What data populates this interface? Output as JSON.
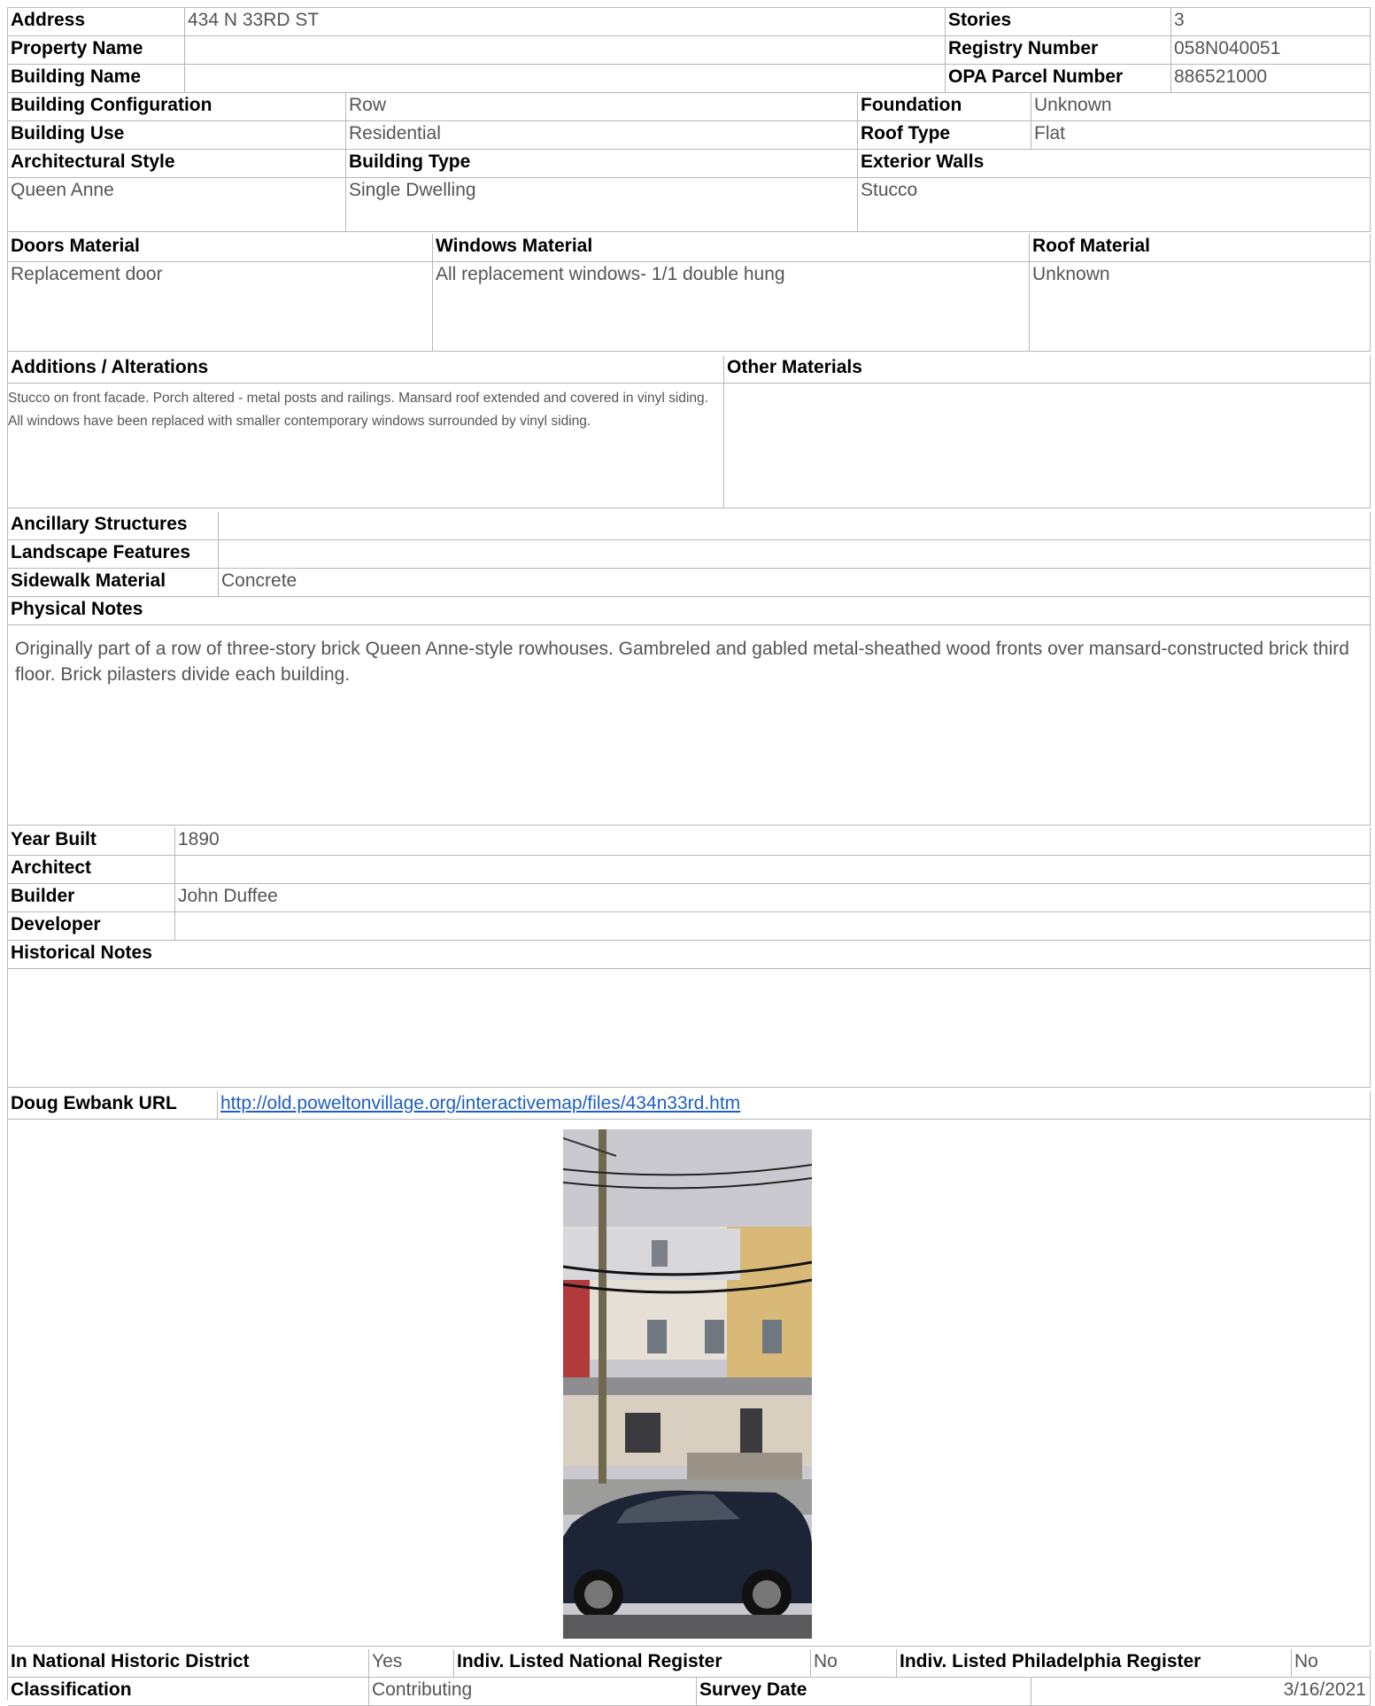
{
  "identity": {
    "address_label": "Address",
    "address": "434 N 33RD ST",
    "property_name_label": "Property Name",
    "property_name": "",
    "building_name_label": "Building Name",
    "building_name": "",
    "stories_label": "Stories",
    "stories": "3",
    "registry_label": "Registry Number",
    "registry": "058N040051",
    "opa_label": "OPA Parcel Number",
    "opa": "886521000"
  },
  "building": {
    "config_label": "Building Configuration",
    "config": "Row",
    "foundation_label": "Foundation",
    "foundation": "Unknown",
    "use_label": "Building Use",
    "use": "Residential",
    "roof_type_label": "Roof Type",
    "roof_type": "Flat",
    "style_label": "Architectural Style",
    "style": "Queen Anne",
    "type_label": "Building Type",
    "type": "Single Dwelling",
    "walls_label": "Exterior Walls",
    "walls": "Stucco"
  },
  "materials": {
    "doors_label": "Doors Material",
    "doors": "Replacement door",
    "windows_label": "Windows Material",
    "windows": "All replacement windows- 1/1 double hung",
    "roof_label": "Roof Material",
    "roof": "Unknown"
  },
  "alterations": {
    "additions_label": "Additions / Alterations",
    "additions": "Stucco on front facade. Porch altered - metal posts and railings. Mansard roof extended and covered in vinyl siding. All windows have been replaced with smaller contemporary windows surrounded by vinyl siding.",
    "other_label": "Other Materials",
    "other": ""
  },
  "site": {
    "ancillary_label": "Ancillary Structures",
    "ancillary": "",
    "landscape_label": "Landscape Features",
    "landscape": "",
    "sidewalk_label": "Sidewalk Material",
    "sidewalk": "Concrete"
  },
  "physical": {
    "label": "Physical Notes",
    "text": "Originally part of a row of three-story brick Queen Anne-style rowhouses. Gambreled and gabled metal-sheathed wood fronts over mansard-constructed brick third floor. Brick pilasters divide each building."
  },
  "history": {
    "year_label": "Year Built",
    "year": "1890",
    "architect_label": "Architect",
    "architect": "",
    "builder_label": "Builder",
    "builder": "John Duffee",
    "developer_label": "Developer",
    "developer": "",
    "notes_label": "Historical Notes",
    "notes": ""
  },
  "links": {
    "ewbank_label": "Doug Ewbank URL",
    "ewbank_url": "http://old.poweltonvillage.org/interactivemap/files/434n33rd.htm"
  },
  "status": {
    "district_label": "In National Historic District",
    "district": "Yes",
    "national_label": "Indiv. Listed National Register",
    "national": "No",
    "phila_label": "Indiv. Listed Philadelphia Register",
    "phila": "No",
    "class_label": "Classification",
    "class": "Contributing",
    "survey_label": "Survey Date",
    "survey": "3/16/2021"
  },
  "photo": {
    "icon": "building-photo"
  }
}
